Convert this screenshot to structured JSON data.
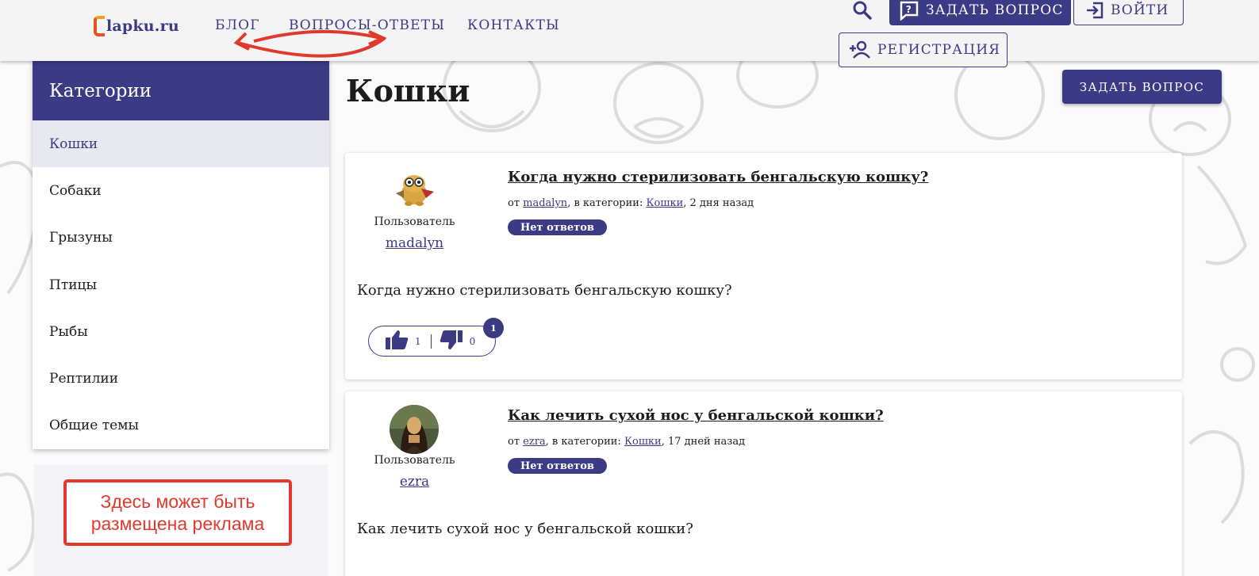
{
  "header": {
    "logo_text": "lapku.ru",
    "nav": [
      "БЛОГ",
      "ВОПРОСЫ-ОТВЕТЫ",
      "КОНТАКТЫ"
    ],
    "ask_label": "ЗАДАТЬ ВОПРОС",
    "login_label": "ВОЙТИ",
    "register_label": "РЕГИСТРАЦИЯ"
  },
  "sidebar": {
    "title": "Категории",
    "items": [
      "Кошки",
      "Собаки",
      "Грызуны",
      "Птицы",
      "Рыбы",
      "Рептилии",
      "Общие темы"
    ],
    "active": "Кошки"
  },
  "ad": {
    "line1": "Здесь может быть",
    "line2": "размещена реклама"
  },
  "main": {
    "title": "Кошки",
    "ask_label": "ЗАДАТЬ ВОПРОС"
  },
  "questions": [
    {
      "user_role": "Пользователь",
      "user_name": "madalyn",
      "avatar_icon": "toy-avatar-icon",
      "title": "Когда нужно стерилизовать бенгальскую кошку?",
      "meta_prefix": "от ",
      "meta_author": "madalyn",
      "meta_mid": ", в категории: ",
      "meta_category": "Кошки",
      "meta_time": ", 2 дня назад",
      "badge": "Нет ответов",
      "body": "Когда нужно стерилизовать бенгальскую кошку?",
      "likes": "1",
      "dislikes": "0",
      "vote_badge": "1"
    },
    {
      "user_role": "Пользователь",
      "user_name": "ezra",
      "avatar_icon": "mona-lisa-avatar-icon",
      "title": "Как лечить сухой нос у бенгальской кошки?",
      "meta_prefix": "от ",
      "meta_author": "ezra",
      "meta_mid": ", в категории: ",
      "meta_category": "Кошки",
      "meta_time": ", 17 дней назад",
      "badge": "Нет ответов",
      "body": "Как лечить сухой нос у бенгальской кошки?"
    }
  ],
  "colors": {
    "brand": "#3b3a85",
    "annotation_red": "#e03a2c"
  }
}
